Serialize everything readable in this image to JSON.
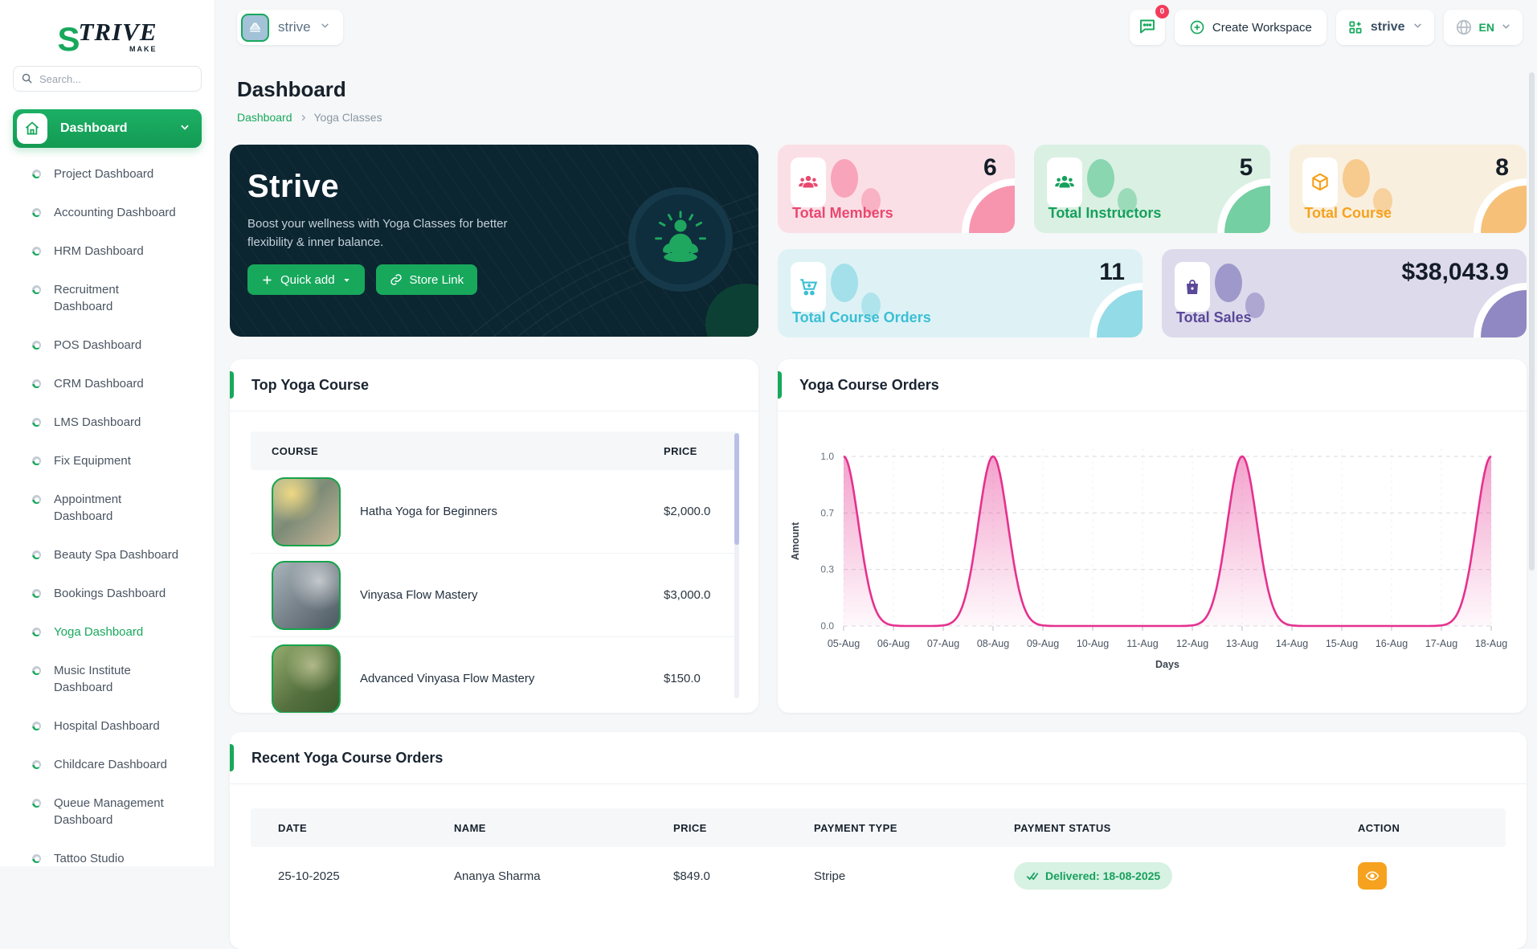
{
  "brand": {
    "letter": "S",
    "name_rest": "TRIVE",
    "tagline": "MAKE"
  },
  "topbar": {
    "workspace_name": "strive",
    "chat_badge": "0",
    "create_workspace_label": "Create Workspace",
    "team_label": "strive",
    "language": "EN"
  },
  "sidebar": {
    "search_placeholder": "Search...",
    "parent_label": "Dashboard",
    "items": [
      {
        "label": "Project Dashboard"
      },
      {
        "label": "Accounting Dashboard"
      },
      {
        "label": "HRM Dashboard"
      },
      {
        "label": "Recruitment Dashboard"
      },
      {
        "label": "POS Dashboard"
      },
      {
        "label": "CRM Dashboard"
      },
      {
        "label": "LMS Dashboard"
      },
      {
        "label": "Fix Equipment"
      },
      {
        "label": "Appointment Dashboard"
      },
      {
        "label": "Beauty Spa Dashboard"
      },
      {
        "label": "Bookings Dashboard"
      },
      {
        "label": "Yoga Dashboard",
        "active": true
      },
      {
        "label": "Music Institute Dashboard"
      },
      {
        "label": "Hospital Dashboard"
      },
      {
        "label": "Childcare Dashboard"
      },
      {
        "label": "Queue Management Dashboard"
      },
      {
        "label": "Tattoo Studio"
      }
    ]
  },
  "page": {
    "title": "Dashboard",
    "breadcrumb_root": "Dashboard",
    "breadcrumb_current": "Yoga Classes"
  },
  "hero": {
    "title": "Strive",
    "subtitle": "Boost your wellness with Yoga Classes for better flexibility & inner balance.",
    "quick_add_label": "Quick add",
    "store_link_label": "Store Link"
  },
  "stats": [
    {
      "label": "Total Members",
      "value": "6"
    },
    {
      "label": "Total Instructors",
      "value": "5"
    },
    {
      "label": "Total Course",
      "value": "8"
    },
    {
      "label": "Total Course Orders",
      "value": "11"
    },
    {
      "label": "Total Sales",
      "value": "$38,043.9"
    }
  ],
  "top_courses": {
    "title": "Top Yoga Course",
    "columns": [
      "COURSE",
      "PRICE"
    ],
    "rows": [
      {
        "name": "Hatha Yoga for Beginners",
        "price": "$2,000.0"
      },
      {
        "name": "Vinyasa Flow Mastery",
        "price": "$3,000.0"
      },
      {
        "name": "Advanced Vinyasa Flow Mastery",
        "price": "$150.0"
      }
    ]
  },
  "chart_data": {
    "type": "area",
    "title": "Yoga Course Orders",
    "categories": [
      "05-Aug",
      "06-Aug",
      "07-Aug",
      "08-Aug",
      "09-Aug",
      "10-Aug",
      "11-Aug",
      "12-Aug",
      "13-Aug",
      "14-Aug",
      "15-Aug",
      "16-Aug",
      "17-Aug",
      "18-Aug"
    ],
    "values": [
      1,
      0,
      0,
      1,
      0,
      0,
      0,
      0,
      1,
      0,
      0,
      0,
      0,
      1
    ],
    "xlabel": "Days",
    "ylabel": "Amount",
    "yticks": [
      0.0,
      0.3,
      0.7,
      1.0
    ],
    "ylim": [
      0,
      1
    ],
    "line_color": "#e5318f",
    "grid": true,
    "legend_position": "none"
  },
  "recent_orders": {
    "title": "Recent Yoga Course Orders",
    "columns": [
      "DATE",
      "NAME",
      "PRICE",
      "PAYMENT TYPE",
      "PAYMENT STATUS",
      "ACTION"
    ],
    "rows": [
      {
        "date": "25-10-2025",
        "name": "Ananya Sharma",
        "price": "$849.0",
        "payment_type": "Stripe",
        "payment_status": "Delivered: 18-08-2025"
      }
    ]
  }
}
